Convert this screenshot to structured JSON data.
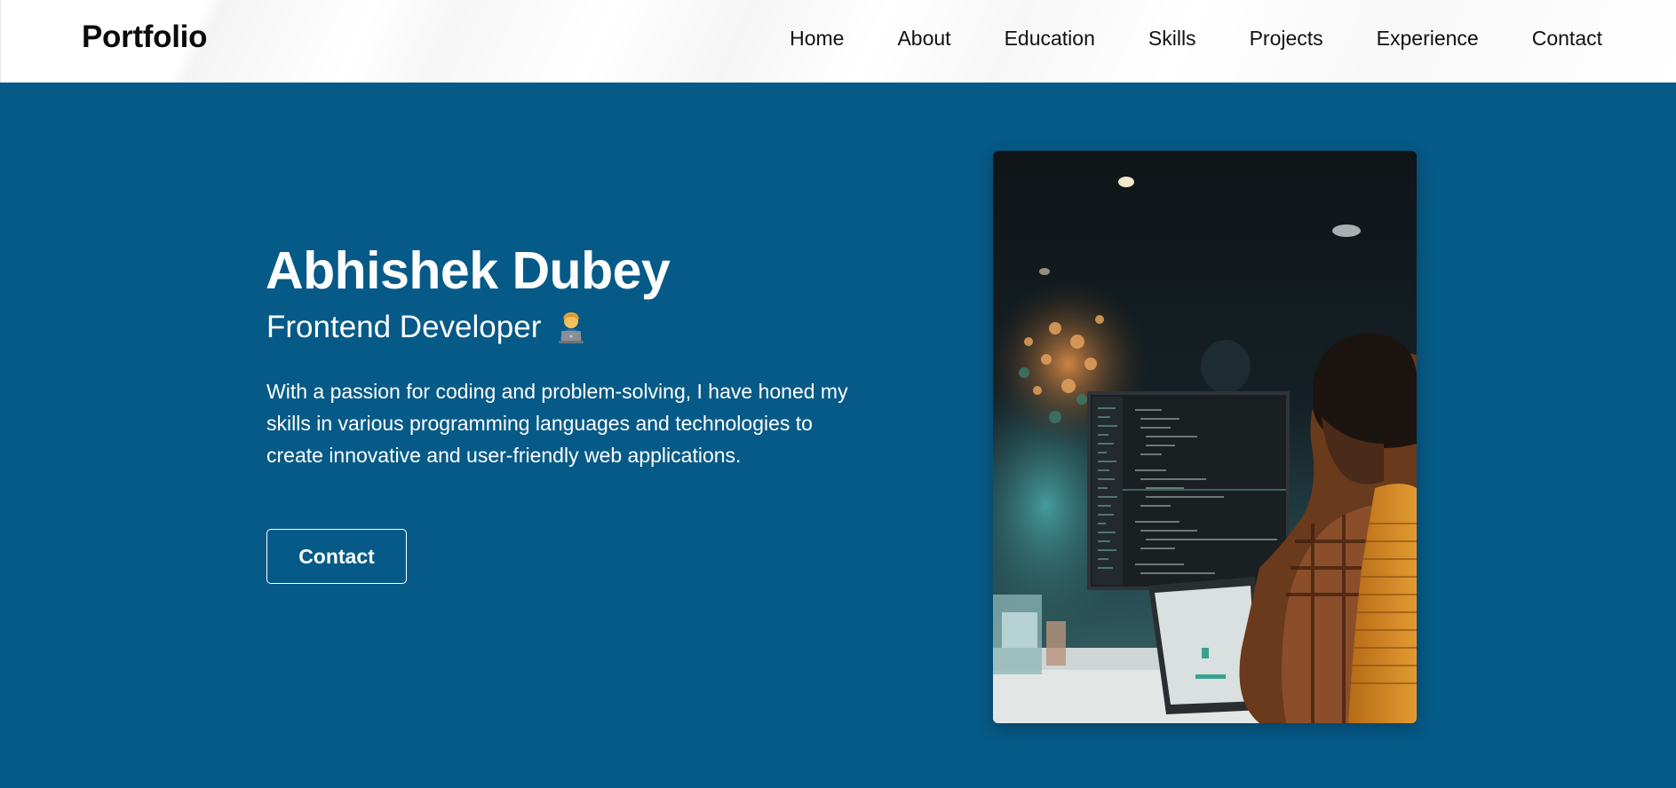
{
  "brand": "Portfolio",
  "nav": {
    "items": [
      "Home",
      "About",
      "Education",
      "Skills",
      "Projects",
      "Experience",
      "Contact"
    ]
  },
  "hero": {
    "name": "Abhishek Dubey",
    "role": "Frontend Developer",
    "role_icon": "technologist-emoji-icon",
    "description": "With a passion for coding and problem-solving, I have honed my skills in various programming languages and technologies to create innovative and user-friendly web applications.",
    "button_label": "Contact",
    "image_subject": "developer-at-workstation-photo"
  },
  "colors": {
    "hero_background": "#065a87",
    "navbar_background": "#ffffff",
    "text_light": "#ffffff",
    "text_dark": "#111111"
  }
}
